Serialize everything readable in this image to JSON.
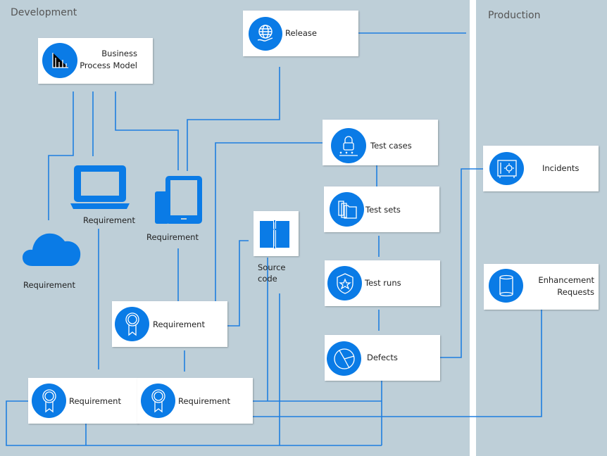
{
  "lanes": {
    "development": "Development",
    "production": "Production"
  },
  "nodes": {
    "release": "Release",
    "bpm_line1": "Business",
    "bpm_line2": "Process Model",
    "req_laptop": "Requirement",
    "req_tablet": "Requirement",
    "req_cloud": "Requirement",
    "req_center": "Requirement",
    "req_bottom_left": "Requirement",
    "req_bottom_right": "Requirement",
    "source_line1": "Source",
    "source_line2": "code",
    "test_cases": "Test cases",
    "test_sets": "Test sets",
    "test_runs": "Test runs",
    "defects": "Defects",
    "incidents": "Incidents",
    "enh_line1": "Enhancement",
    "enh_line2": "Requests"
  },
  "colors": {
    "accent": "#0a7be6",
    "lane": "#becfd8",
    "line": "#1f7fe0"
  }
}
